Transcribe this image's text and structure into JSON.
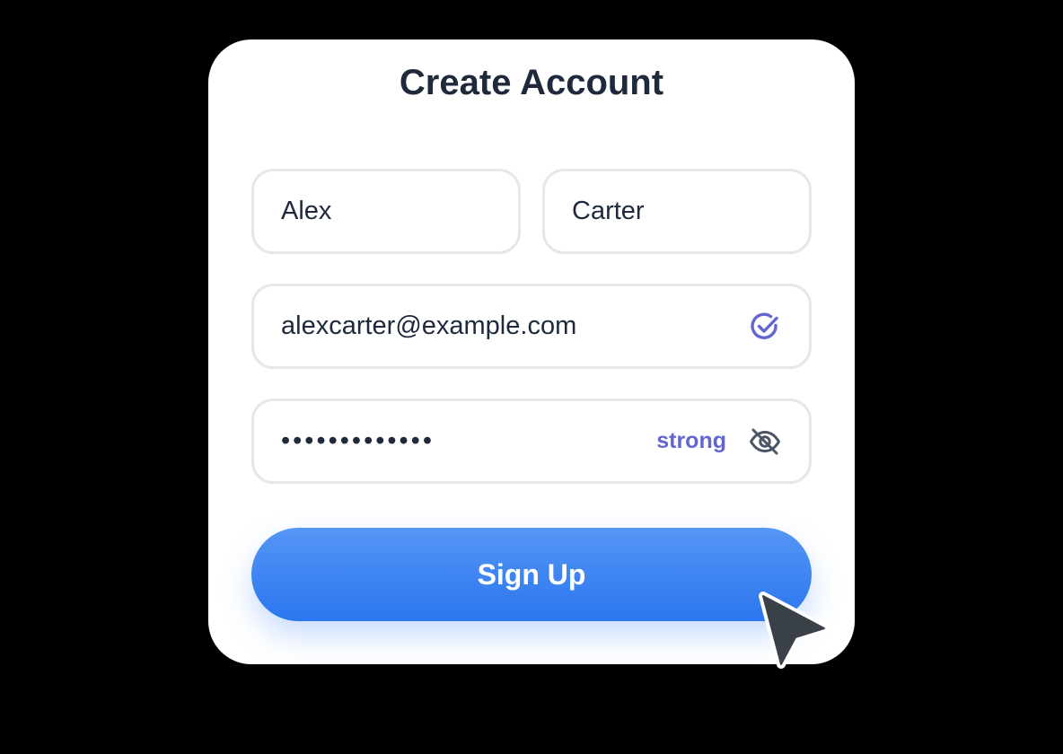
{
  "form": {
    "title": "Create Account",
    "first_name": {
      "value": "Alex"
    },
    "last_name": {
      "value": "Carter"
    },
    "email": {
      "value": "alexcarter@example.com",
      "status_icon": "check-circle-icon"
    },
    "password": {
      "masked_value": "•••••••••••••",
      "strength": "strong",
      "toggle_icon": "eye-off-icon"
    },
    "submit_label": "Sign Up"
  },
  "colors": {
    "accent": "#6366d1",
    "button_top": "#5596f5",
    "button_bottom": "#2b76ef",
    "title": "#1e293b",
    "field_border": "#e5e7eb",
    "background": "#000000"
  }
}
